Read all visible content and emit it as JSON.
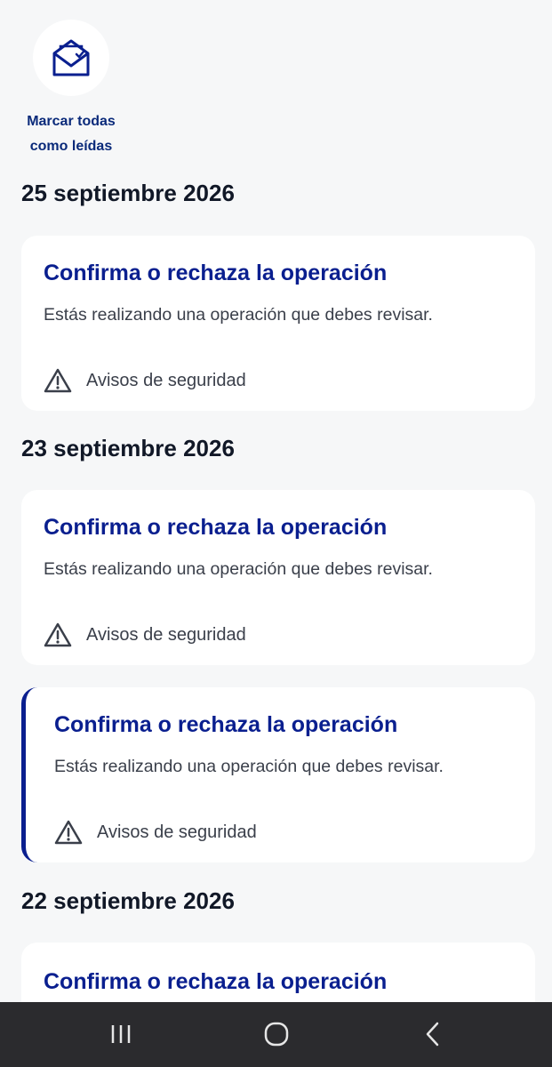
{
  "header": {
    "mark_all_line1": "Marcar todas",
    "mark_all_line2": "como leídas",
    "icon": "envelope-open-icon"
  },
  "groups": [
    {
      "date": "25 septiembre 2026",
      "notifications": [
        {
          "title": "Confirma o rechaza la operación",
          "description": "Estás realizando una operación que debes revisar.",
          "category": "Avisos de seguridad",
          "icon": "warning-triangle-icon",
          "unread": false
        }
      ]
    },
    {
      "date": "23 septiembre 2026",
      "notifications": [
        {
          "title": "Confirma o rechaza la operación",
          "description": "Estás realizando una operación que debes revisar.",
          "category": "Avisos de seguridad",
          "icon": "warning-triangle-icon",
          "unread": false
        },
        {
          "title": "Confirma o rechaza la operación",
          "description": "Estás realizando una operación que debes revisar.",
          "category": "Avisos de seguridad",
          "icon": "warning-triangle-icon",
          "unread": true
        }
      ]
    },
    {
      "date": "22 septiembre 2026",
      "notifications": [
        {
          "title": "Confirma o rechaza la operación",
          "unread": false
        }
      ]
    }
  ],
  "navbar": {
    "recents_icon": "recent-apps-icon",
    "home_icon": "home-icon",
    "back_icon": "back-chevron-icon"
  },
  "colors": {
    "background": "#f6f7f8",
    "card": "#ffffff",
    "title_blue": "#0a1f8f",
    "unread_accent": "#0a1f8f",
    "navbar": "#2b2b2e"
  }
}
